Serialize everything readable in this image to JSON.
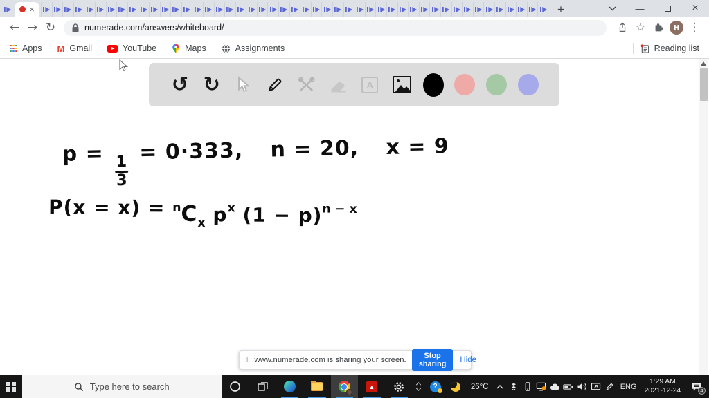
{
  "browser": {
    "tab_strip": {
      "favicon_count": 47
    },
    "glyphs": {
      "tab_close": "×",
      "new_tab": "+",
      "minimize": "—",
      "close": "×",
      "back": "←",
      "forward": "→",
      "reload": "↻",
      "star": "☆",
      "menu_dots": "⋮"
    },
    "nav": {
      "url": "numerade.com/answers/whiteboard/"
    },
    "profile": {
      "initial": "H"
    },
    "bookmarks": {
      "apps": "Apps",
      "gmail": "Gmail",
      "gmail_glyph": "M",
      "youtube": "YouTube",
      "maps": "Maps",
      "assignments": "Assignments",
      "reading_list": "Reading list"
    }
  },
  "whiteboard": {
    "tool_glyphs": {
      "undo": "↺",
      "redo": "↻",
      "text_tool": "A"
    },
    "palette": {
      "black": "#000000",
      "red": "#efa9a7",
      "green": "#a5c9a5",
      "purple": "#a6a9ea"
    },
    "line1": {
      "lhs": "p =",
      "frac_num": "1",
      "frac_den": "3",
      "mid": "= 0·333,",
      "n_part": "n = 20,",
      "x_part": "x = 9"
    },
    "line2": {
      "lhs": "P(x = x) =",
      "c_pre_sup": "n",
      "c": "C",
      "c_sub": "x",
      "p": "p",
      "p_sup": "x",
      "factor": "(1 − p)",
      "factor_sup": "n − x"
    }
  },
  "share_banner": {
    "message": "www.numerade.com is sharing your screen.",
    "stop_button": "Stop sharing",
    "hide_link": "Hide"
  },
  "taskbar": {
    "search_placeholder": "Type here to search",
    "help_glyph": "?",
    "temperature": "26°C",
    "language": "ENG",
    "time": "1:29 AM",
    "date": "2021-12-24",
    "notification_count": "4",
    "adobe_glyph": "▲"
  }
}
